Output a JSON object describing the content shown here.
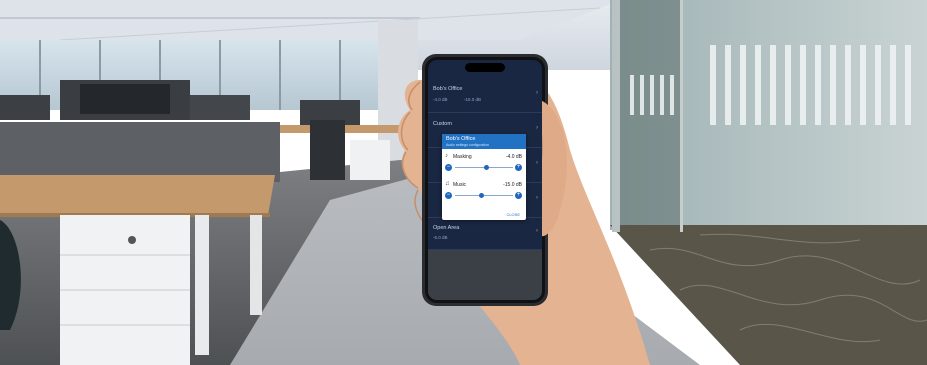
{
  "app": {
    "rooms": [
      {
        "name": "Bob's Office",
        "masking": "-4.0 dB",
        "music": "-15.0 dB"
      },
      {
        "name": "Custom",
        "masking": "",
        "music": ""
      },
      {
        "name": "",
        "masking": "",
        "music": ""
      },
      {
        "name": "",
        "masking": "",
        "music": ""
      },
      {
        "name": "Open Area",
        "masking": "-5.0 dB",
        "music": ""
      }
    ],
    "popup": {
      "title": "Bob's Office",
      "subtitle": "Audio settings configuration",
      "masking_label": "Masking",
      "masking_value": "-4.0 dB",
      "masking_level": 0.55,
      "music_label": "Music",
      "music_value": "-15.0 dB",
      "music_level": 0.45,
      "minus_symbol": "−",
      "plus_symbol": "+",
      "close_label": "CLOSE"
    },
    "chevron": "›"
  },
  "colors": {
    "screen_bg": "#1a2742",
    "popup_header": "#2272c4",
    "accent": "#1f67b8"
  },
  "icons": {
    "masking": "speaker-wave-icon",
    "music": "music-note-icon"
  }
}
